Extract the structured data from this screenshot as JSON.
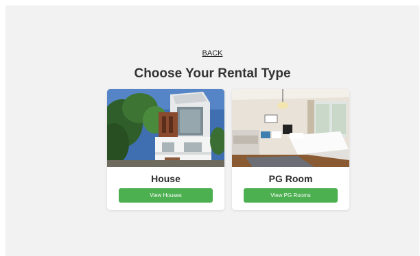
{
  "back_link": "BACK",
  "page_title": "Choose Your Rental Type",
  "cards": [
    {
      "title": "House",
      "button_label": "View Houses",
      "image": "house-photo"
    },
    {
      "title": "PG Room",
      "button_label": "View PG Rooms",
      "image": "pg-room-photo"
    }
  ],
  "colors": {
    "page_background": "#f2f2f2",
    "card_background": "#ffffff",
    "button": "#4caf50",
    "button_text": "#ffffff",
    "heading_text": "#333333"
  }
}
